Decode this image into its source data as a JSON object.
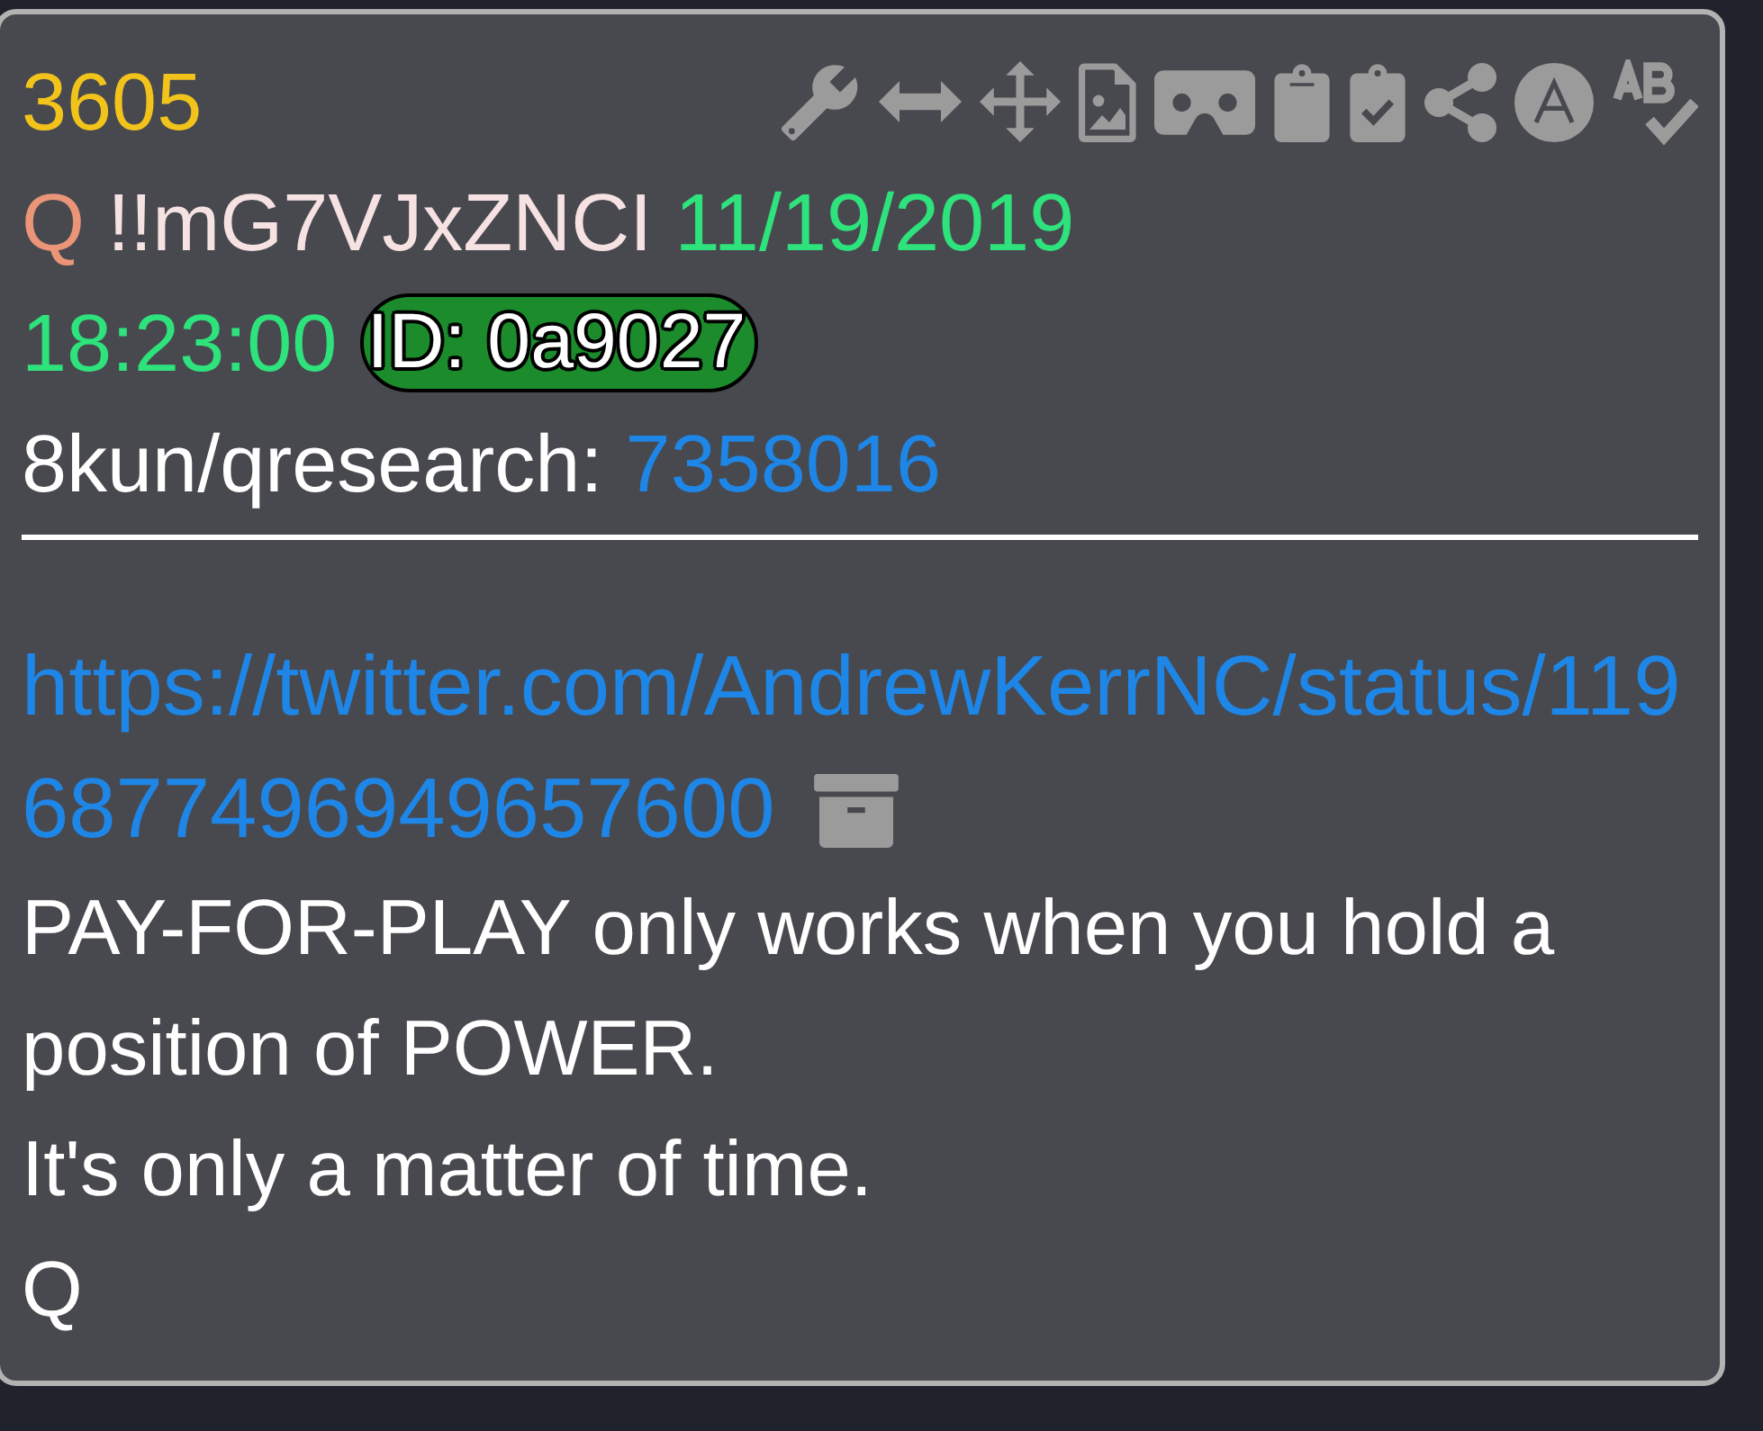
{
  "post": {
    "number": "3605",
    "name": "Q",
    "tripcode": "!!mG7VJxZNCI",
    "date": "11/19/2019",
    "time": "18:23:00",
    "id_badge": "ID: 0a9027",
    "board": "8kun/qresearch:",
    "thread_link": "7358016"
  },
  "body": {
    "link": "https://twitter.com/AndrewKerrNC/status/1196877496949657600",
    "paragraphs": [
      "PAY-FOR-PLAY only works when you hold a position of POWER.",
      "It's only a matter of time.",
      "Q"
    ]
  }
}
